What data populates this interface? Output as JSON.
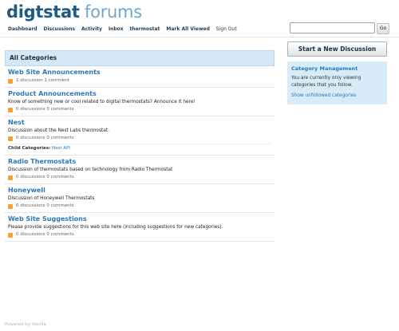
{
  "header": {
    "logo_part1": "digtstat",
    "logo_part2": "forums",
    "go_label": "Go"
  },
  "nav": {
    "items": [
      "Dashboard",
      "Discussions",
      "Activity",
      "Inbox",
      "thermostat",
      "Mark All Viewed"
    ],
    "sign_out": "Sign Out"
  },
  "main": {
    "heading": "All Categories",
    "categories": [
      {
        "title": "Web Site Announcements",
        "description": "",
        "meta": "1 discussion 1 comment"
      },
      {
        "title": "Product Announcements",
        "description": "Know of something new or cool related to digital thermostats? Announce it here!",
        "meta": "0 discussions 0 comments"
      },
      {
        "title": "Nest",
        "description": "Discussion about the Nest Labs thermostat.",
        "meta": "0 discussions 0 comments",
        "child_label": "Child Categories:",
        "child_link": "Nest API"
      },
      {
        "title": "Radio Thermostats",
        "description": "Discussion of thermostats based on technology from Radio Thermostat",
        "meta": "0 discussions 0 comments"
      },
      {
        "title": "Honeywell",
        "description": "Discussion of Honeywell Thermostats",
        "meta": "0 discussions 0 comments"
      },
      {
        "title": "Web Site Suggestions",
        "description": "Please provide suggestions for this web site here (including suggestions for new categories).",
        "meta": "0 discussions 0 comments"
      }
    ]
  },
  "sidebar": {
    "new_discussion": "Start a New Discussion",
    "box_title": "Category Management",
    "box_text": "You are currently only viewing categories that you follow.",
    "box_link": "Show unfollowed categories"
  },
  "footer": {
    "powered": "Powered by Vanilla"
  },
  "colors": {
    "accent": "#2a78b8",
    "header_bg": "#d4e8f7",
    "rss": "#f3a03a"
  }
}
